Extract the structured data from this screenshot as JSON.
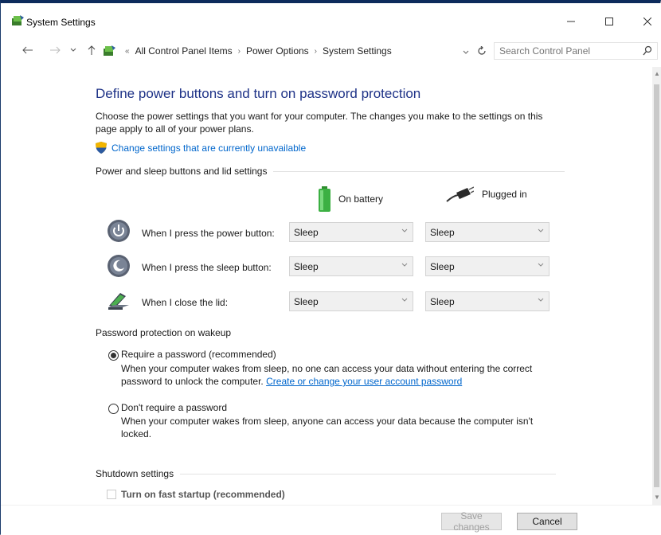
{
  "window": {
    "title": "System Settings"
  },
  "nav": {
    "back_icon": "back-arrow-icon",
    "forward_icon": "forward-arrow-icon",
    "recent_icon": "chevron-down-icon",
    "up_icon": "up-arrow-icon",
    "overflow": "«",
    "breadcrumbs": [
      "All Control Panel Items",
      "Power Options",
      "System Settings"
    ],
    "search_placeholder": "Search Control Panel"
  },
  "page": {
    "title": "Define power buttons and turn on password protection",
    "description": "Choose the power settings that you want for your computer. The changes you make to the settings on this page apply to all of your power plans.",
    "change_link": "Change settings that are currently unavailable"
  },
  "power_section": {
    "heading": "Power and sleep buttons and lid settings",
    "columns": {
      "battery": "On battery",
      "plugged": "Plugged in"
    },
    "rows": [
      {
        "label": "When I press the power button:",
        "battery": "Sleep",
        "plugged": "Sleep"
      },
      {
        "label": "When I press the sleep button:",
        "battery": "Sleep",
        "plugged": "Sleep"
      },
      {
        "label": "When I close the lid:",
        "battery": "Sleep",
        "plugged": "Sleep"
      }
    ]
  },
  "password_section": {
    "heading": "Password protection on wakeup",
    "require": {
      "label": "Require a password (recommended)",
      "desc": "When your computer wakes from sleep, no one can access your data without entering the correct password to unlock the computer.",
      "link": "Create or change your user account password",
      "checked": true
    },
    "dont_require": {
      "label": "Don't require a password",
      "desc": "When your computer wakes from sleep, anyone can access your data because the computer isn't locked.",
      "checked": false
    }
  },
  "shutdown_section": {
    "heading": "Shutdown settings",
    "fast_startup": "Turn on fast startup (recommended)"
  },
  "footer": {
    "save": "Save changes",
    "cancel": "Cancel"
  },
  "colors": {
    "title_blue": "#1e3287",
    "link_blue": "#0066cc",
    "frame_navy": "#0d2b5c"
  }
}
